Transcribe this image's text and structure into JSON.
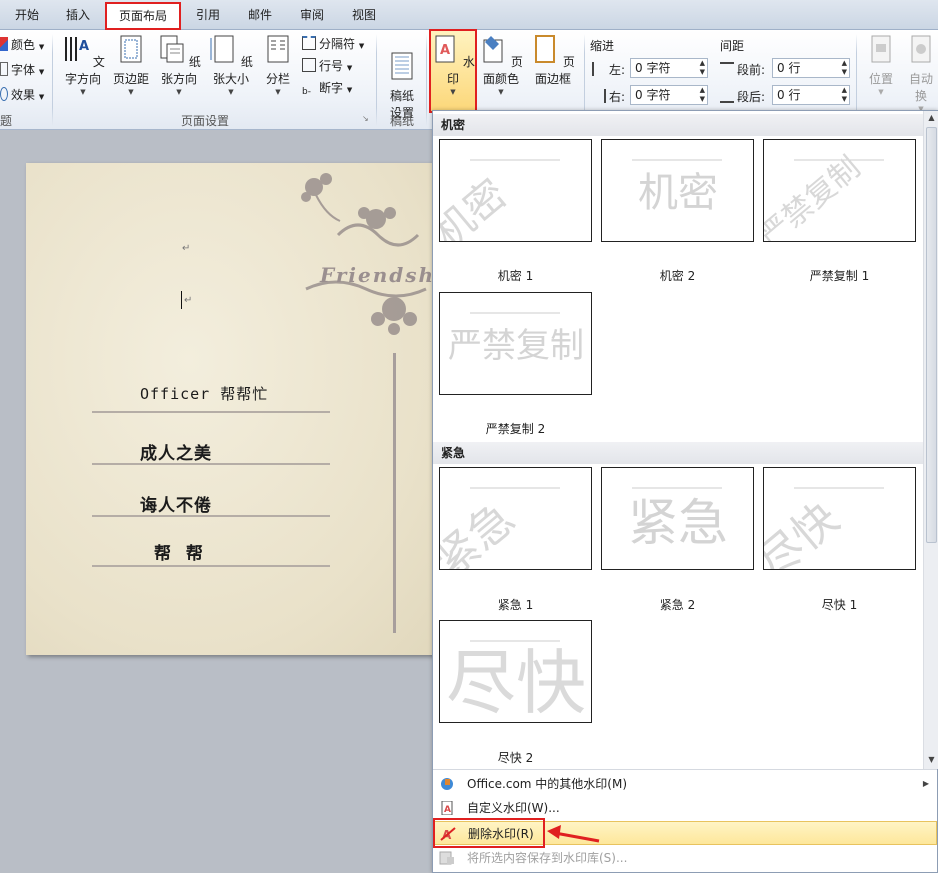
{
  "tabs": [
    "开始",
    "插入",
    "页面布局",
    "引用",
    "邮件",
    "审阅",
    "视图"
  ],
  "ribbon": {
    "theme_items": [
      "颜色",
      "字体",
      "效果"
    ],
    "theme_group_label": "题",
    "page_setup": {
      "buttons": [
        "文字方向",
        "页边距",
        "纸张方向",
        "纸张大小",
        "分栏"
      ],
      "small_items": [
        "分隔符",
        "行号",
        "断字"
      ],
      "group_label": "页面设置"
    },
    "draft": {
      "button": "稿纸\n设置",
      "group_label": "稿纸"
    },
    "background": {
      "watermark": "水印",
      "page_color": "页面颜色",
      "page_border": "页面边框"
    },
    "indent": {
      "title": "缩进",
      "left_label": "左:",
      "left_value": "0 字符",
      "right_label": "右:",
      "right_value": "0 字符"
    },
    "spacing": {
      "title": "间距",
      "before_label": "段前:",
      "before_value": "0 行",
      "after_label": "段后:",
      "after_value": "0 行"
    },
    "arrange": {
      "position": "位置",
      "wrap": "自动换"
    }
  },
  "document": {
    "logo_text": "Friendsh",
    "lines": [
      "Officer 帮帮忙",
      "成人之美",
      "诲人不倦",
      "帮  帮"
    ],
    "para_mark": "↵"
  },
  "gallery": {
    "sections": [
      {
        "title": "机密",
        "items": [
          {
            "label": "机密 1",
            "text": "机密",
            "style": "diagonal"
          },
          {
            "label": "机密 2",
            "text": "机密",
            "style": "horizontal"
          },
          {
            "label": "严禁复制 1",
            "text": "严禁复制",
            "style": "diagonal"
          },
          {
            "label": "严禁复制 2",
            "text": "严禁复制",
            "style": "horizontal"
          }
        ]
      },
      {
        "title": "紧急",
        "items": [
          {
            "label": "紧急 1",
            "text": "紧急",
            "style": "diagonal"
          },
          {
            "label": "紧急 2",
            "text": "紧急",
            "style": "horizontal"
          },
          {
            "label": "尽快 1",
            "text": "尽快",
            "style": "diagonal"
          },
          {
            "label": "尽快 2",
            "text": "尽快",
            "style": "horizontal"
          }
        ]
      }
    ]
  },
  "menu": {
    "more_office": "Office.com 中的其他水印(M)",
    "custom": "自定义水印(W)...",
    "remove": "删除水印(R)",
    "save_selection": "将所选内容保存到水印库(S)..."
  },
  "colors": {
    "highlight_red": "#e02020",
    "menu_hover": "#fde79b"
  }
}
